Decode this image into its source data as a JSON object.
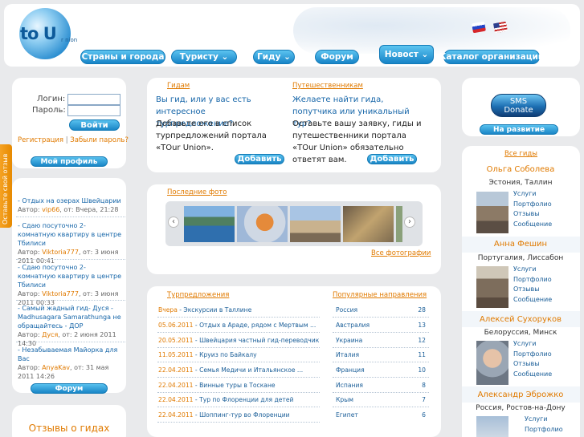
{
  "header": {
    "logo_text": "to U",
    "logo_sub": "r nion"
  },
  "nav": [
    {
      "label": "Страны и города"
    },
    {
      "label": "Туристу ⌄"
    },
    {
      "label": "Гиду ⌄"
    },
    {
      "label": "Форум"
    },
    {
      "label": "Новост ⌄"
    },
    {
      "label": "Каталог организаций"
    }
  ],
  "login": {
    "login_label": "Логин:",
    "password_label": "Пароль:",
    "submit": "Войти",
    "register": "Регистрация",
    "forgot": "Забыли пароль?",
    "profile": "Мой профиль"
  },
  "side_tab": "Оставьте свой отзыв",
  "forum_posts": [
    {
      "title": "- Отдых на озерах Швейцарии",
      "author_label": "Автор:",
      "author": "vip66",
      "from": "от:",
      "date": "Вчера, 21:28"
    },
    {
      "title": "- Сдаю посуточно 2-комнатную квартиру в центре Тбилиси",
      "author_label": "Автор:",
      "author": "Viktoria777",
      "from": "от:",
      "date": "3 июня 2011 00:41"
    },
    {
      "title": "- Сдаю посуточно 2-комнатную квартиру в центре Тбилиси",
      "author_label": "Автор:",
      "author": "Viktoria777",
      "from": "от:",
      "date": "3 июня 2011 00:33"
    },
    {
      "title": "- Самый жадный гид- Дуся - Madhusagara Samarathunga не обращайтесь - ДОР",
      "author_label": "Автор:",
      "author": "Дуся",
      "from": "от:",
      "date": "2 июня 2011 14:30"
    },
    {
      "title": "- Незабываемая Майорка для Вас",
      "author_label": "Автор:",
      "author": "AnyaKav",
      "from": "от:",
      "date": "31 мая 2011 14:26"
    }
  ],
  "forum_button": "Форум",
  "reviews_title": "Отзывы о гидах",
  "promo": {
    "guides_tab": "Гидам",
    "travelers_tab": "Путешественникам",
    "guides_q": "Вы гид, или у вас есть интересное турпредложение?",
    "guides_text": "Добавьте его в список турпредложений портала «TOur Union».",
    "travelers_q": "Желаете найти гида, попутчика или уникальный тур?",
    "travelers_text": "Оставьте вашу заявку, гиды и путешественники портала «TOur Union» обязательно ответят вам.",
    "add_button": "Добавить"
  },
  "photos": {
    "title": "Последние фото",
    "all": "Все фотографии",
    "prev": "‹",
    "next": "›"
  },
  "offers": {
    "title": "Турпредложения",
    "items": [
      {
        "date": "Вчера",
        "title": "Экскурсии в Таллине"
      },
      {
        "date": "05.06.2011",
        "title": "Отдых в Араде, рядом с Мертвым ..."
      },
      {
        "date": "20.05.2011",
        "title": "Швейцария частный гид-переводчик"
      },
      {
        "date": "11.05.2011",
        "title": "Круиз по Байкалу"
      },
      {
        "date": "22.04.2011",
        "title": "Семья Медичи и Итальянское ..."
      },
      {
        "date": "22.04.2011",
        "title": "Винные туры в Тоскане"
      },
      {
        "date": "22.04.2011",
        "title": "Тур по Флоренции для детей"
      },
      {
        "date": "22.04.2011",
        "title": "Шоппинг-тур во Флоренции"
      }
    ]
  },
  "popular": {
    "title": "Популярные направления",
    "items": [
      {
        "name": "Россия",
        "count": "28"
      },
      {
        "name": "Австралия",
        "count": "13"
      },
      {
        "name": "Украина",
        "count": "12"
      },
      {
        "name": "Италия",
        "count": "11"
      },
      {
        "name": "Франция",
        "count": "10"
      },
      {
        "name": "Испания",
        "count": "8"
      },
      {
        "name": "Крым",
        "count": "7"
      },
      {
        "name": "Египет",
        "count": "6"
      }
    ]
  },
  "sms": {
    "line1": "SMS",
    "line2": "Donate",
    "dev": "На развитие"
  },
  "guides": {
    "all": "Все гиды",
    "links": [
      "Услуги",
      "Портфолио",
      "Отзывы",
      "Сообщение"
    ],
    "items": [
      {
        "name": "Ольга Соболева",
        "loc": "Эстония, Таллин"
      },
      {
        "name": "Анна Фешин",
        "loc": "Португалия, Лиссабон"
      },
      {
        "name": "Алексей Сухоруков",
        "loc": "Белоруссия, Минск"
      },
      {
        "name": "Александр Эброжко",
        "loc": "Россия, Ростов-на-Дону"
      }
    ]
  },
  "colors": {
    "accent": "#1a86c6",
    "link": "#e07a00",
    "text_blue": "#1565a8"
  }
}
